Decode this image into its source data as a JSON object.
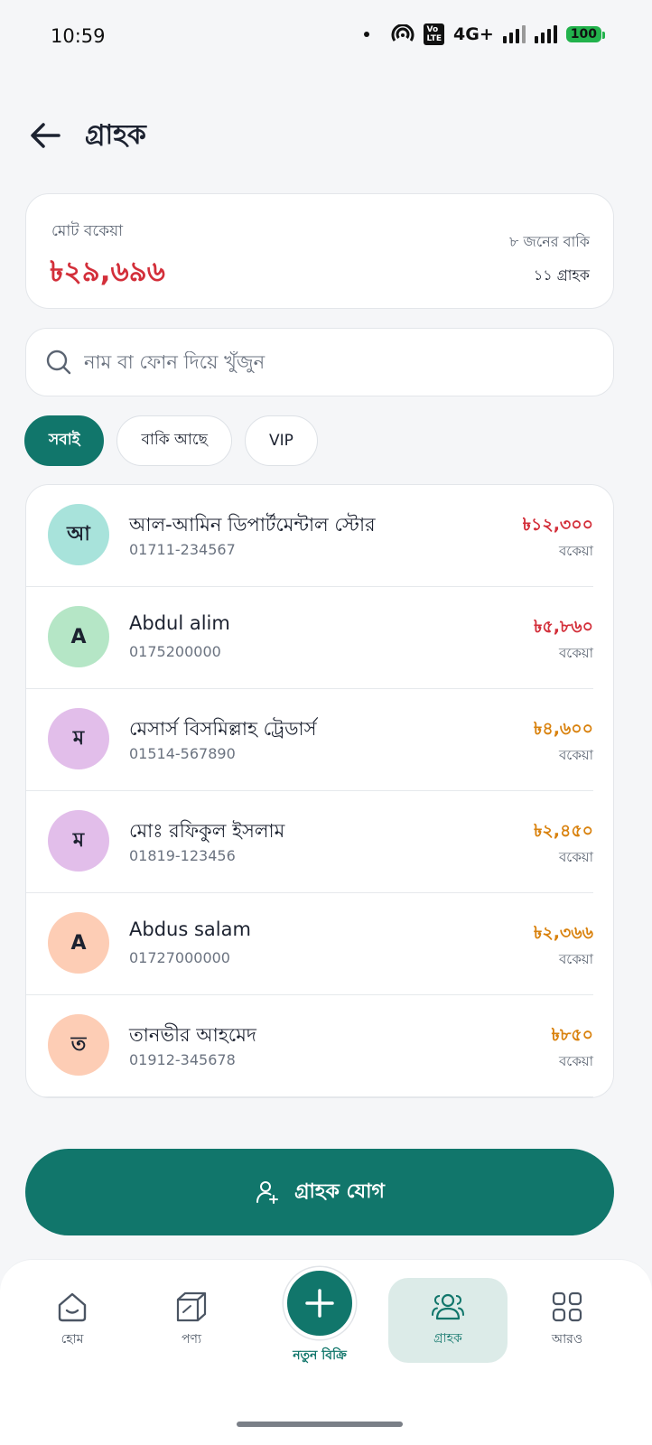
{
  "status_bar": {
    "time": "10:59",
    "network": "4G+",
    "battery": "100"
  },
  "header": {
    "title": "গ্রাহক"
  },
  "summary": {
    "label": "মোট বকেয়া",
    "total": "৳২৯,৬৯৬",
    "due_count": "৮ জনের বাকি",
    "customer_count": "১১ গ্রাহক"
  },
  "search": {
    "placeholder": "নাম বা ফোন দিয়ে খুঁজুন"
  },
  "filters": [
    {
      "label": "সবাই",
      "active": true
    },
    {
      "label": "বাকি আছে",
      "active": false
    },
    {
      "label": "VIP",
      "active": false
    }
  ],
  "customers": [
    {
      "initial": "আ",
      "name": "আল-আমিন ডিপার্টমেন্টাল স্টোর",
      "phone": "01711-234567",
      "amount": "৳১২,৩০০",
      "amount_label": "বকেয়া",
      "avatar_color": "#A8E3DB",
      "amount_color": "#D32F3A"
    },
    {
      "initial": "A",
      "name": "Abdul alim",
      "phone": "0175200000",
      "amount": "৳৫,৮৬০",
      "amount_label": "বকেয়া",
      "avatar_color": "#B5E6C6",
      "amount_color": "#D32F3A"
    },
    {
      "initial": "ম",
      "name": "মেসার্স বিসমিল্লাহ ট্রেডার্স",
      "phone": "01514-567890",
      "amount": "৳৪,৬০০",
      "amount_label": "বকেয়া",
      "avatar_color": "#E2BEEA",
      "amount_color": "#D9820E"
    },
    {
      "initial": "ম",
      "name": "মোঃ রফিকুল ইসলাম",
      "phone": "01819-123456",
      "amount": "৳২,৪৫০",
      "amount_label": "বকেয়া",
      "avatar_color": "#E2BEEA",
      "amount_color": "#D9820E"
    },
    {
      "initial": "A",
      "name": "Abdus salam",
      "phone": "01727000000",
      "amount": "৳২,৩৬৬",
      "amount_label": "বকেয়া",
      "avatar_color": "#FDCDB5",
      "amount_color": "#D9820E"
    },
    {
      "initial": "ত",
      "name": "তানভীর আহমেদ",
      "phone": "01912-345678",
      "amount": "৳৮৫০",
      "amount_label": "বকেয়া",
      "avatar_color": "#FDCDB5",
      "amount_color": "#D9820E"
    }
  ],
  "add_button": {
    "label": "গ্রাহক যোগ"
  },
  "nav": {
    "home": "হোম",
    "products": "পণ্য",
    "new_sale": "নতুন বিক্রি",
    "customers": "গ্রাহক",
    "more": "আরও"
  },
  "colors": {
    "primary": "#11766B",
    "due_red": "#D32F3A",
    "due_orange": "#D9820E"
  }
}
